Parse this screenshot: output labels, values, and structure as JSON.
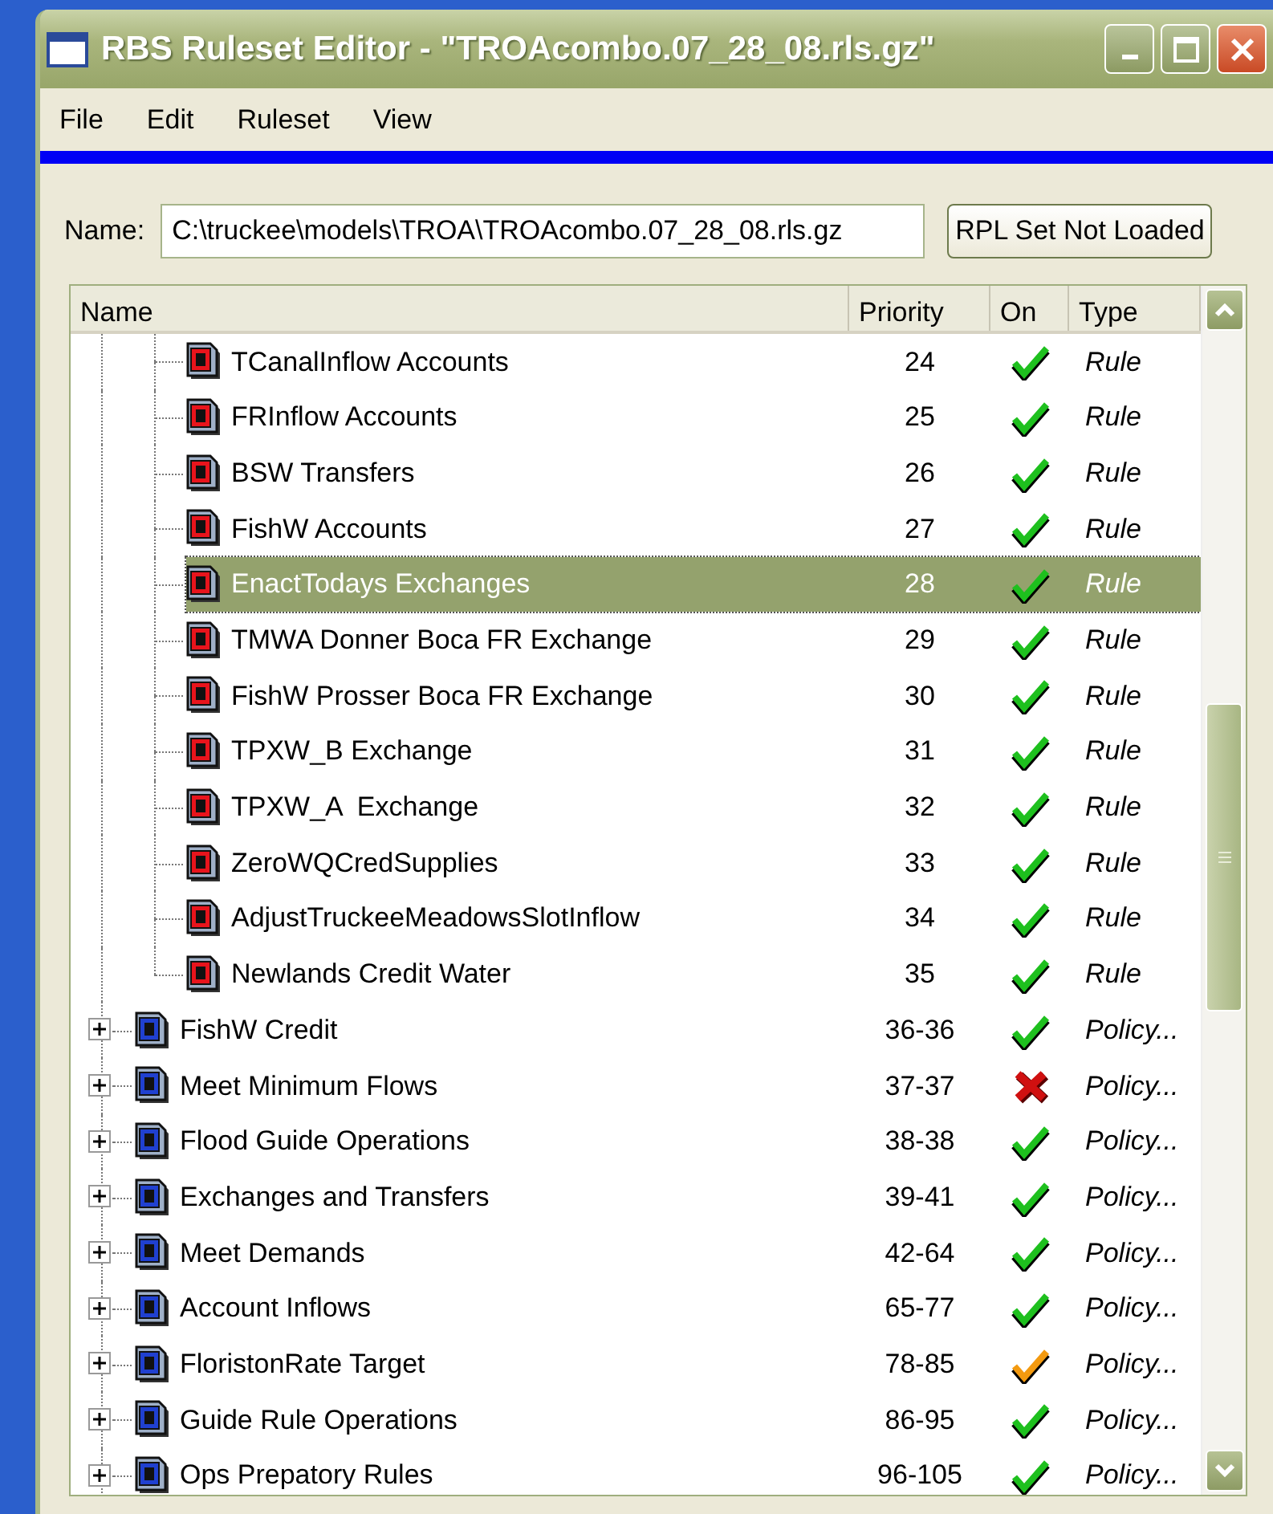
{
  "window": {
    "title": "RBS Ruleset Editor - \"TROAcombo.07_28_08.rls.gz\""
  },
  "menu": [
    "File",
    "Edit",
    "Ruleset",
    "View"
  ],
  "name_field": {
    "label": "Name:",
    "value": "C:\\truckee\\models\\TROA\\TROAcombo.07_28_08.rls.gz"
  },
  "rpl_button": "RPL Set Not Loaded",
  "tree": {
    "columns": [
      "Name",
      "Priority",
      "On",
      "Type"
    ],
    "rows": [
      {
        "kind": "rule",
        "name": "TCanalInflow Accounts",
        "priority": "24",
        "on": true,
        "partial": false,
        "type": "Rule",
        "selected": false
      },
      {
        "kind": "rule",
        "name": "FRInflow Accounts",
        "priority": "25",
        "on": true,
        "partial": false,
        "type": "Rule",
        "selected": false
      },
      {
        "kind": "rule",
        "name": "BSW Transfers",
        "priority": "26",
        "on": true,
        "partial": false,
        "type": "Rule",
        "selected": false
      },
      {
        "kind": "rule",
        "name": "FishW Accounts",
        "priority": "27",
        "on": true,
        "partial": false,
        "type": "Rule",
        "selected": false
      },
      {
        "kind": "rule",
        "name": "EnactTodays Exchanges",
        "priority": "28",
        "on": true,
        "partial": false,
        "type": "Rule",
        "selected": true
      },
      {
        "kind": "rule",
        "name": "TMWA Donner Boca FR Exchange",
        "priority": "29",
        "on": true,
        "partial": false,
        "type": "Rule",
        "selected": false
      },
      {
        "kind": "rule",
        "name": "FishW Prosser Boca FR Exchange",
        "priority": "30",
        "on": true,
        "partial": false,
        "type": "Rule",
        "selected": false
      },
      {
        "kind": "rule",
        "name": "TPXW_B Exchange",
        "priority": "31",
        "on": true,
        "partial": false,
        "type": "Rule",
        "selected": false
      },
      {
        "kind": "rule",
        "name": "TPXW_A  Exchange",
        "priority": "32",
        "on": true,
        "partial": false,
        "type": "Rule",
        "selected": false
      },
      {
        "kind": "rule",
        "name": "ZeroWQCredSupplies",
        "priority": "33",
        "on": true,
        "partial": false,
        "type": "Rule",
        "selected": false
      },
      {
        "kind": "rule",
        "name": "AdjustTruckeeMeadowsSlotInflow",
        "priority": "34",
        "on": true,
        "partial": false,
        "type": "Rule",
        "selected": false
      },
      {
        "kind": "rule",
        "name": "Newlands Credit Water",
        "priority": "35",
        "on": true,
        "partial": false,
        "type": "Rule",
        "selected": false
      },
      {
        "kind": "group",
        "name": "FishW Credit",
        "priority": "36-36",
        "on": true,
        "partial": false,
        "type": "Policy...",
        "expanded": false,
        "selected": false
      },
      {
        "kind": "group",
        "name": "Meet Minimum Flows",
        "priority": "37-37",
        "on": false,
        "partial": false,
        "type": "Policy...",
        "expanded": false,
        "selected": false
      },
      {
        "kind": "group",
        "name": "Flood Guide Operations",
        "priority": "38-38",
        "on": true,
        "partial": false,
        "type": "Policy...",
        "expanded": false,
        "selected": false
      },
      {
        "kind": "group",
        "name": "Exchanges and Transfers",
        "priority": "39-41",
        "on": true,
        "partial": false,
        "type": "Policy...",
        "expanded": false,
        "selected": false
      },
      {
        "kind": "group",
        "name": "Meet Demands",
        "priority": "42-64",
        "on": true,
        "partial": false,
        "type": "Policy...",
        "expanded": false,
        "selected": false
      },
      {
        "kind": "group",
        "name": "Account Inflows",
        "priority": "65-77",
        "on": true,
        "partial": false,
        "type": "Policy...",
        "expanded": false,
        "selected": false
      },
      {
        "kind": "group",
        "name": "FloristonRate Target",
        "priority": "78-85",
        "on": true,
        "partial": true,
        "type": "Policy...",
        "expanded": false,
        "selected": false
      },
      {
        "kind": "group",
        "name": "Guide Rule Operations",
        "priority": "86-95",
        "on": true,
        "partial": false,
        "type": "Policy...",
        "expanded": false,
        "selected": false
      },
      {
        "kind": "group",
        "name": "Ops Prepatory Rules",
        "priority": "96-105",
        "on": true,
        "partial": false,
        "type": "Policy...",
        "expanded": false,
        "selected": false
      }
    ]
  }
}
